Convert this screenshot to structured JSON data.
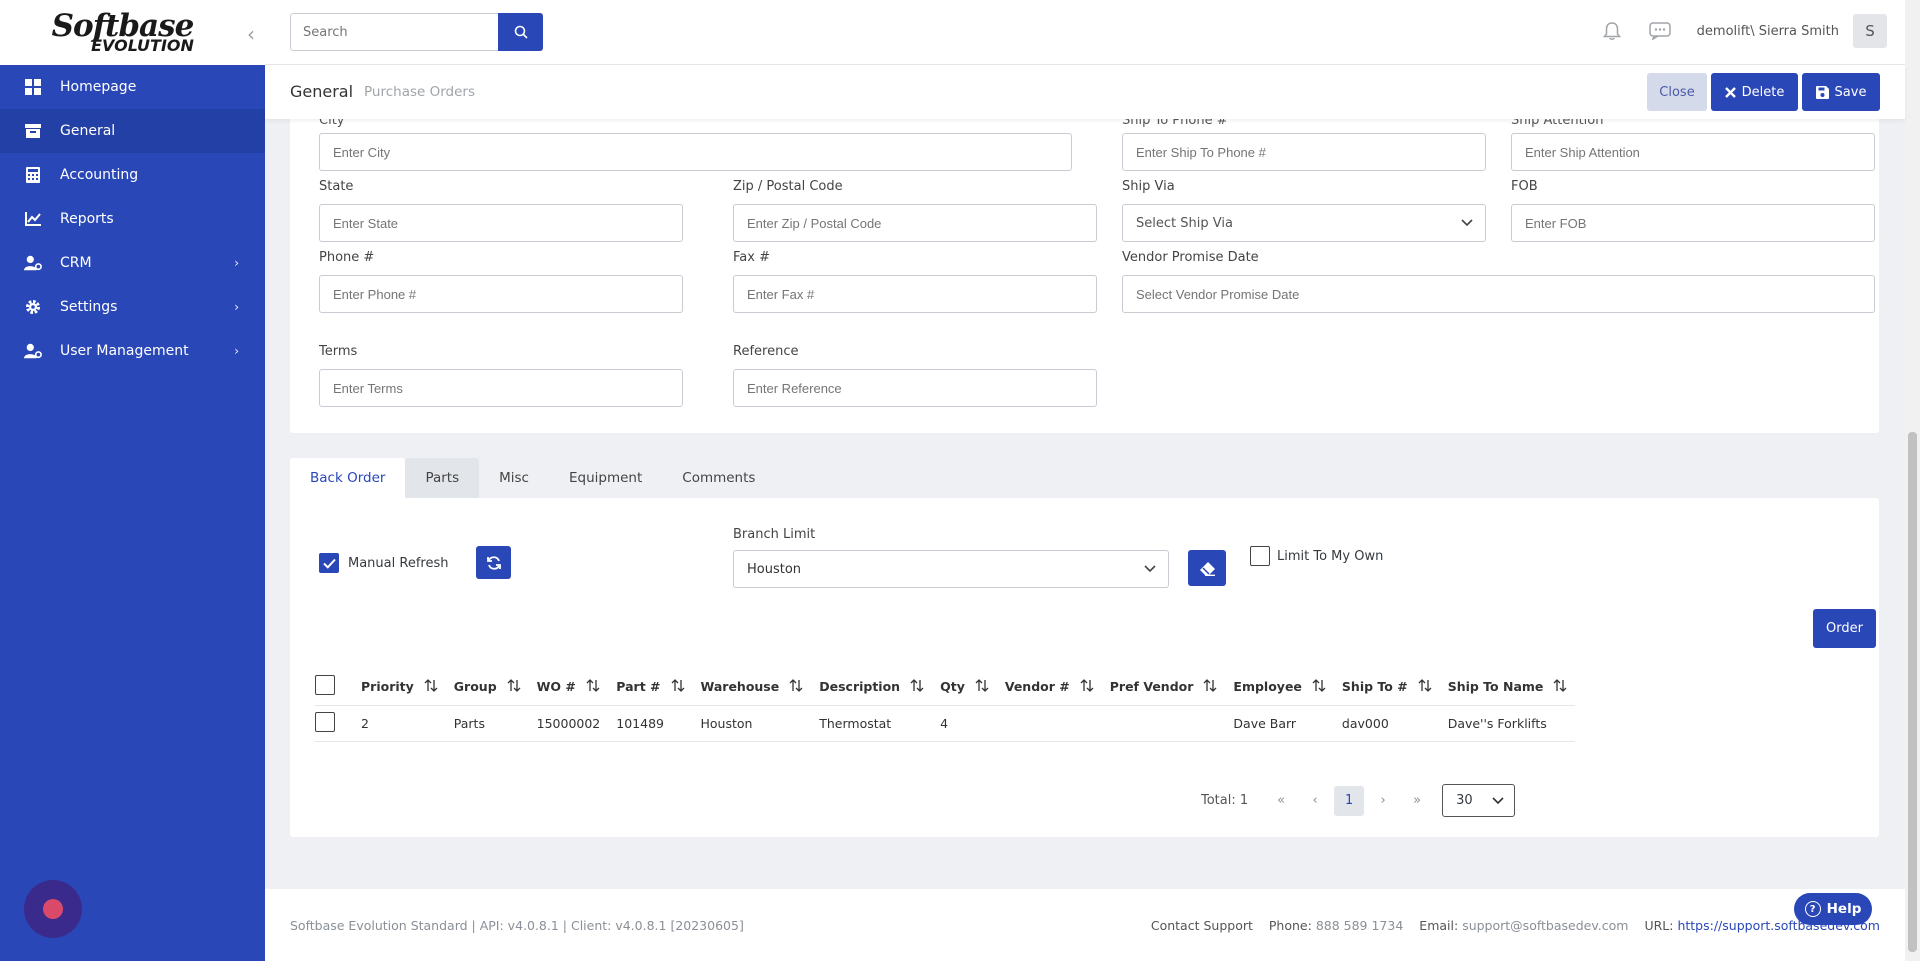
{
  "app": {
    "logo_main": "Softbase",
    "logo_sub": "EVOLUTION"
  },
  "sidebar": {
    "items": [
      {
        "label": "Homepage"
      },
      {
        "label": "General"
      },
      {
        "label": "Accounting"
      },
      {
        "label": "Reports"
      },
      {
        "label": "CRM"
      },
      {
        "label": "Settings"
      },
      {
        "label": "User Management"
      }
    ]
  },
  "topbar": {
    "search_placeholder": "Search",
    "user_name": "demolift\\ Sierra Smith",
    "avatar_initial": "S"
  },
  "header": {
    "title": "General",
    "breadcrumb": "Purchase Orders",
    "close_label": "Close",
    "delete_label": "Delete",
    "save_label": "Save"
  },
  "form": {
    "city_label": "City",
    "city_placeholder": "Enter City",
    "ship_to_phone_label": "Ship To Phone #",
    "ship_to_phone_placeholder": "Enter Ship To Phone #",
    "ship_attention_label": "Ship Attention",
    "ship_attention_placeholder": "Enter Ship Attention",
    "state_label": "State",
    "state_placeholder": "Enter State",
    "zip_label": "Zip / Postal Code",
    "zip_placeholder": "Enter Zip / Postal Code",
    "ship_via_label": "Ship Via",
    "ship_via_placeholder": "Select Ship Via",
    "fob_label": "FOB",
    "fob_placeholder": "Enter FOB",
    "phone_label": "Phone #",
    "phone_placeholder": "Enter Phone #",
    "fax_label": "Fax #",
    "fax_placeholder": "Enter Fax #",
    "vendor_promise_label": "Vendor Promise Date",
    "vendor_promise_placeholder": "Select Vendor Promise Date",
    "terms_label": "Terms",
    "terms_placeholder": "Enter Terms",
    "reference_label": "Reference",
    "reference_placeholder": "Enter Reference"
  },
  "tabs": [
    {
      "label": "Back Order",
      "active": true
    },
    {
      "label": "Parts"
    },
    {
      "label": "Misc"
    },
    {
      "label": "Equipment"
    },
    {
      "label": "Comments"
    }
  ],
  "back_order": {
    "manual_refresh_label": "Manual Refresh",
    "manual_refresh_checked": true,
    "branch_limit_label": "Branch Limit",
    "branch_limit_value": "Houston",
    "limit_to_my_own_label": "Limit To My Own",
    "limit_to_my_own_checked": false,
    "order_label": "Order"
  },
  "grid": {
    "columns": [
      "Priority",
      "Group",
      "WO #",
      "Part #",
      "Warehouse",
      "Description",
      "Qty",
      "Vendor #",
      "Pref Vendor",
      "Employee",
      "Ship To #",
      "Ship To Name"
    ],
    "rows": [
      [
        "2",
        "Parts",
        "15000002",
        "101489",
        "Houston",
        "Thermostat",
        "4",
        "",
        "",
        "Dave Barr",
        "dav000",
        "Dave''s Forklifts"
      ]
    ],
    "total_label": "Total: 1",
    "current_page": "1",
    "page_size": "30"
  },
  "footer": {
    "version": "Softbase Evolution Standard | API: v4.0.8.1 | Client: v4.0.8.1 [20230605]",
    "contact_support": "Contact Support",
    "phone_key": "Phone:",
    "phone_value": "888 589 1734",
    "email_key": "Email:",
    "email_value": "support@softbasedev.com",
    "url_key": "URL:",
    "url_value": "https://support.softbasedev.com"
  },
  "help": {
    "label": "Help"
  },
  "colors": {
    "primary": "#2a47b8",
    "sidebar": "#2a47b8"
  }
}
